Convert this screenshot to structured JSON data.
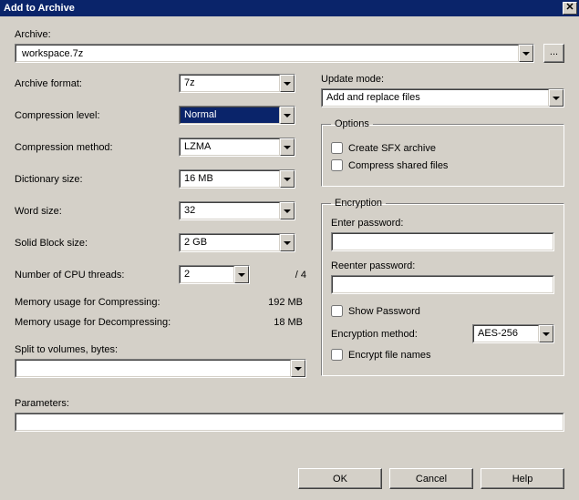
{
  "title": "Add to Archive",
  "archive": {
    "label": "Archive:",
    "value": "workspace.7z",
    "browse": "..."
  },
  "left": {
    "format_label": "Archive format:",
    "format_value": "7z",
    "level_label": "Compression level:",
    "level_value": "Normal",
    "method_label": "Compression method:",
    "method_value": "LZMA",
    "dict_label": "Dictionary size:",
    "dict_value": "16 MB",
    "word_label": "Word size:",
    "word_value": "32",
    "block_label": "Solid Block size:",
    "block_value": "2 GB",
    "threads_label": "Number of CPU threads:",
    "threads_value": "2",
    "threads_total": "/ 4",
    "memc_label": "Memory usage for Compressing:",
    "memc_value": "192 MB",
    "memd_label": "Memory usage for Decompressing:",
    "memd_value": "18 MB",
    "split_label": "Split to volumes, bytes:",
    "split_value": ""
  },
  "right": {
    "update_label": "Update mode:",
    "update_value": "Add and replace files",
    "options_legend": "Options",
    "sfx_label": "Create SFX archive",
    "shared_label": "Compress shared files",
    "enc_legend": "Encryption",
    "pw_label": "Enter password:",
    "repw_label": "Reenter password:",
    "showpw_label": "Show Password",
    "encmethod_label": "Encryption method:",
    "encmethod_value": "AES-256",
    "encnames_label": "Encrypt file names"
  },
  "params": {
    "label": "Parameters:",
    "value": ""
  },
  "buttons": {
    "ok": "OK",
    "cancel": "Cancel",
    "help": "Help"
  }
}
